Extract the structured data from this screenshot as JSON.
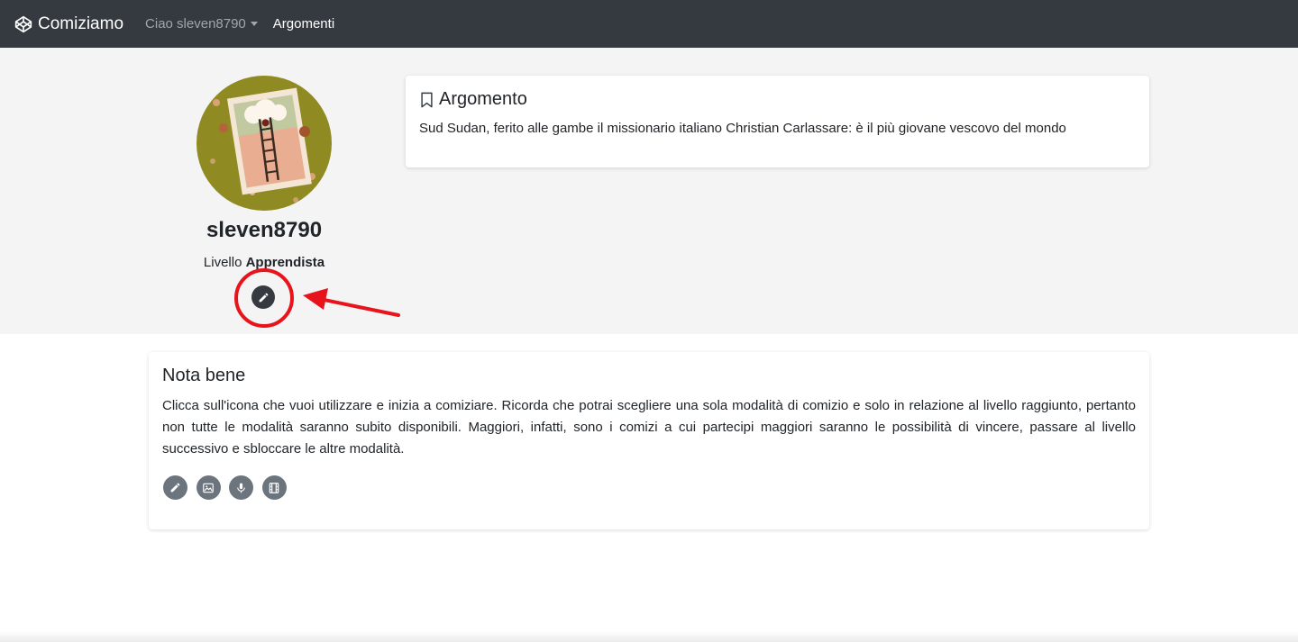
{
  "navbar": {
    "brand": "Comiziamo",
    "brand_icon": "codepen-icon",
    "user_menu": "Ciao sleven8790",
    "link_topics": "Argomenti"
  },
  "profile": {
    "username": "sleven8790",
    "level_label": "Livello",
    "level_value": "Apprendista",
    "edit_icon": "pencil-icon"
  },
  "topic": {
    "title": "Argomento",
    "icon": "bookmark-icon",
    "text": "Sud Sudan, ferito alle gambe il missionario italiano Christian Carlassare: è il più giovane vescovo del mondo"
  },
  "note": {
    "title": "Nota bene",
    "text": "Clicca sull'icona che vuoi utilizzare e inizia a comiziare. Ricorda che potrai scegliere una sola modalità di comizio e solo in relazione al livello raggiunto, pertanto non tutte le modalità saranno subito disponibili. Maggiori, infatti, sono i comizi a cui partecipi maggiori saranno le possibilità di vincere, passare al livello successivo e sbloccare le altre modalità.",
    "modes": [
      "pencil-icon",
      "image-icon",
      "microphone-icon",
      "film-icon"
    ]
  },
  "colors": {
    "navbar": "#343a40",
    "hero": "#f4f4f4",
    "highlight": "#e8141b",
    "mode_button": "#6c757d"
  }
}
